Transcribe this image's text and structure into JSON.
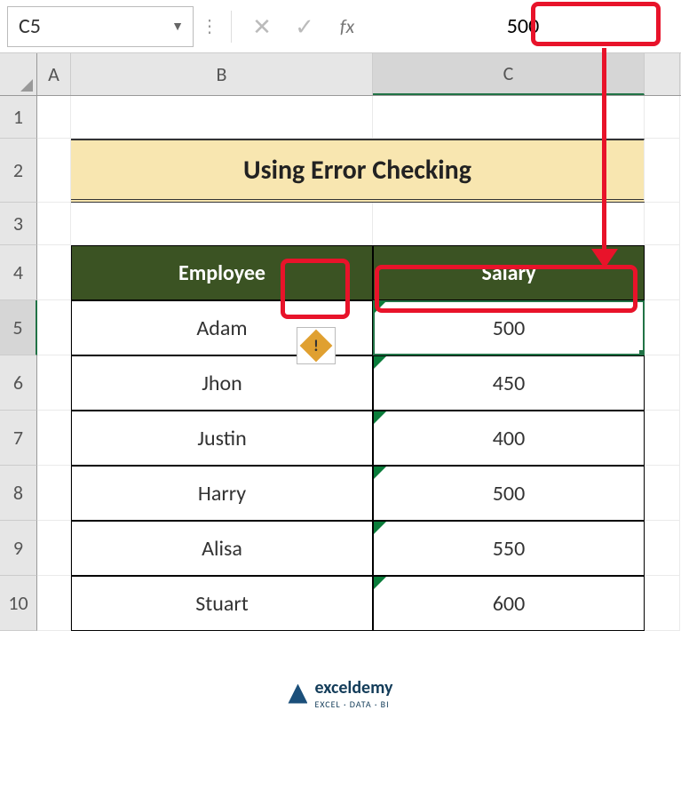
{
  "formula_bar": {
    "name_box": "C5",
    "fx_label": "fx",
    "value": "500"
  },
  "columns": {
    "a": "A",
    "b": "B",
    "c": "C"
  },
  "rows": [
    "1",
    "2",
    "3",
    "4",
    "5",
    "6",
    "7",
    "8",
    "9",
    "10"
  ],
  "title": "Using Error Checking",
  "headers": {
    "employee": "Employee",
    "salary": "Salary"
  },
  "table": [
    {
      "employee": "Adam",
      "salary": "500"
    },
    {
      "employee": "Jhon",
      "salary": "450"
    },
    {
      "employee": "Justin",
      "salary": "400"
    },
    {
      "employee": "Harry",
      "salary": "500"
    },
    {
      "employee": "Alisa",
      "salary": "550"
    },
    {
      "employee": "Stuart",
      "salary": "600"
    }
  ],
  "smart_tag": "!",
  "footer": {
    "brand": "exceldemy",
    "sub": "EXCEL · DATA · BI"
  }
}
